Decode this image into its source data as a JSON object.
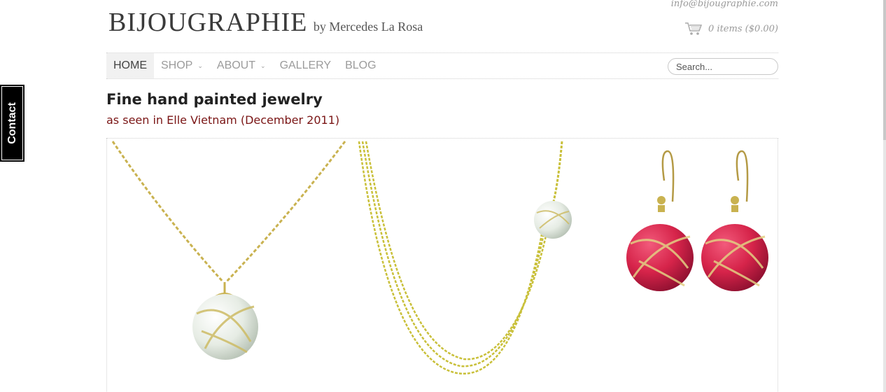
{
  "header": {
    "email": "info@bijougraphie.com",
    "brand_name": "BIJOUGRAPHIE",
    "brand_byline": "by Mercedes La Rosa",
    "cart_summary": "0 items ($0.00)"
  },
  "nav": {
    "items": [
      {
        "label": "HOME",
        "active": true,
        "has_dropdown": false
      },
      {
        "label": "SHOP",
        "active": false,
        "has_dropdown": true
      },
      {
        "label": "ABOUT",
        "active": false,
        "has_dropdown": true
      },
      {
        "label": "GALLERY",
        "active": false,
        "has_dropdown": false
      },
      {
        "label": "BLOG",
        "active": false,
        "has_dropdown": false
      }
    ],
    "search_placeholder": "Search..."
  },
  "main": {
    "headline": "Fine hand painted jewelry",
    "subheadline": "as seen in Elle Vietnam (December 2011)"
  },
  "contact_tab": {
    "label": "Contact"
  },
  "colors": {
    "subheadline": "#7a1515",
    "gold_chain": "#c9b250",
    "pearl_white": "#e6ece4",
    "earring_red": "#d6244a"
  },
  "icons": {
    "cart": "cart-icon",
    "dropdown": "chevron-down-icon"
  }
}
